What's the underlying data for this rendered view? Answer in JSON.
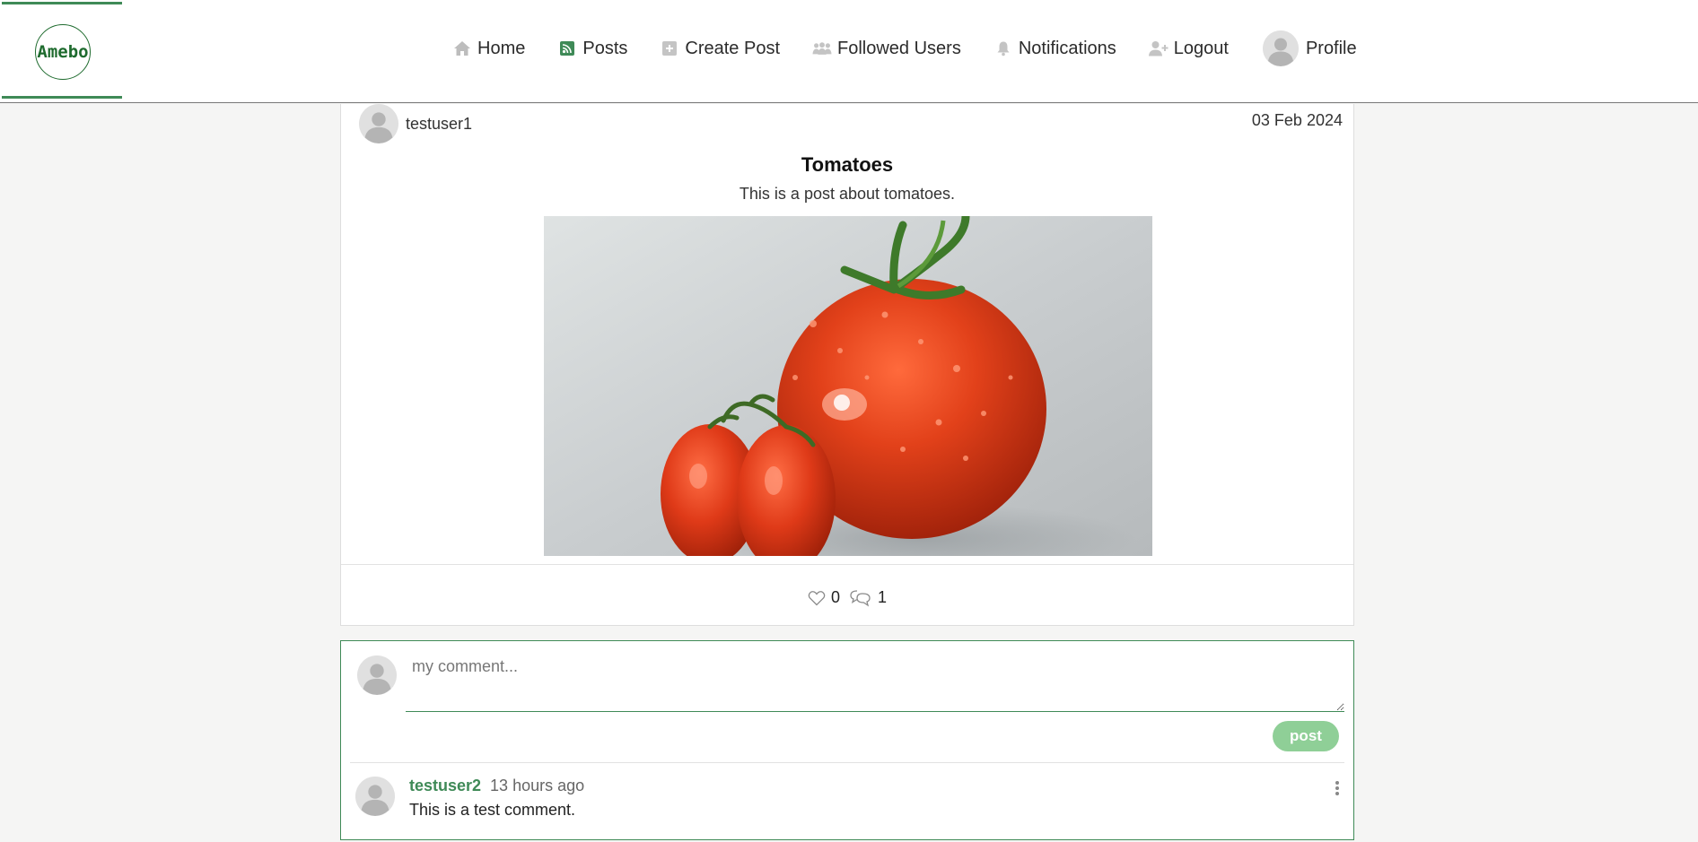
{
  "app": {
    "logo_text": "Amebo"
  },
  "nav": {
    "items": [
      {
        "label": "Home",
        "icon": "home-icon"
      },
      {
        "label": "Posts",
        "icon": "rss-icon"
      },
      {
        "label": "Create Post",
        "icon": "plus-square-icon"
      },
      {
        "label": "Followed Users",
        "icon": "users-icon"
      },
      {
        "label": "Notifications",
        "icon": "bell-icon"
      },
      {
        "label": "Logout",
        "icon": "user-plus-icon"
      }
    ],
    "profile_label": "Profile"
  },
  "post": {
    "author": "testuser1",
    "date": "03 Feb 2024",
    "title": "Tomatoes",
    "body": "This is a post about tomatoes.",
    "image_alt": "tomatoes",
    "likes": "0",
    "comments_count": "1"
  },
  "composer": {
    "placeholder": "my comment...",
    "value": "",
    "submit_label": "post"
  },
  "comments": [
    {
      "author": "testuser2",
      "time": "13 hours ago",
      "text": "This is a test comment."
    }
  ],
  "colors": {
    "brand": "#3f8a57",
    "logo": "#1e6b2e",
    "button": "#8fcf97",
    "background": "#f5f5f4"
  }
}
